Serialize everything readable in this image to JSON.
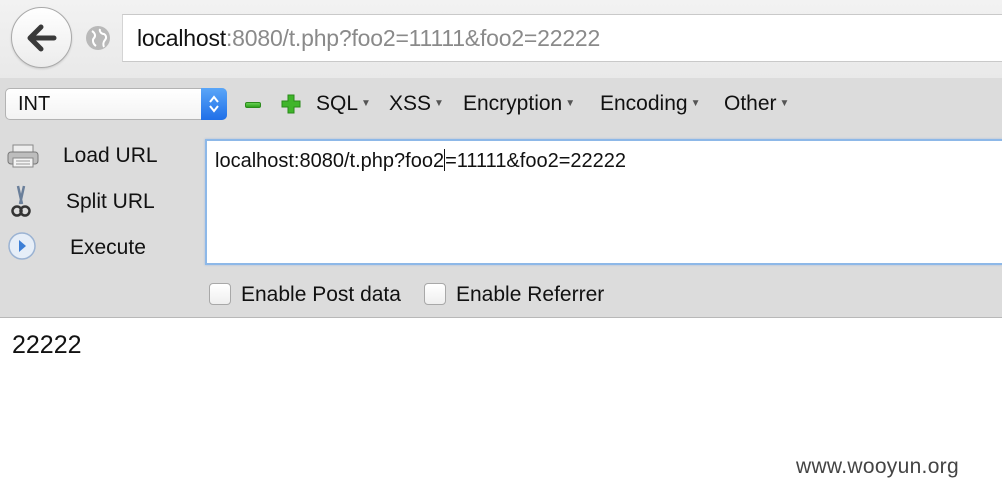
{
  "browser": {
    "url_host": "localhost",
    "url_rest": ":8080/t.php?foo2=11111&foo2=22222"
  },
  "hackbar": {
    "select_value": "INT",
    "menus": [
      "SQL",
      "XSS",
      "Encryption",
      "Encoding",
      "Other"
    ],
    "actions": [
      {
        "label": "Load URL",
        "icon": "load-url-icon"
      },
      {
        "label": "Split URL",
        "icon": "scissors-icon"
      },
      {
        "label": "Execute",
        "icon": "execute-icon"
      }
    ],
    "url_before_caret": "localhost:8080/t.php?foo2",
    "url_after_caret": "=11111&foo2=22222",
    "enable_post_label": "Enable Post data",
    "enable_referrer_label": "Enable Referrer"
  },
  "page": {
    "result": "22222",
    "watermark": "www.wooyun.org"
  },
  "colors": {
    "accent": "#1f6fe8",
    "green": "#2ea21c",
    "toolbar_bg": "#dcdcdc"
  }
}
